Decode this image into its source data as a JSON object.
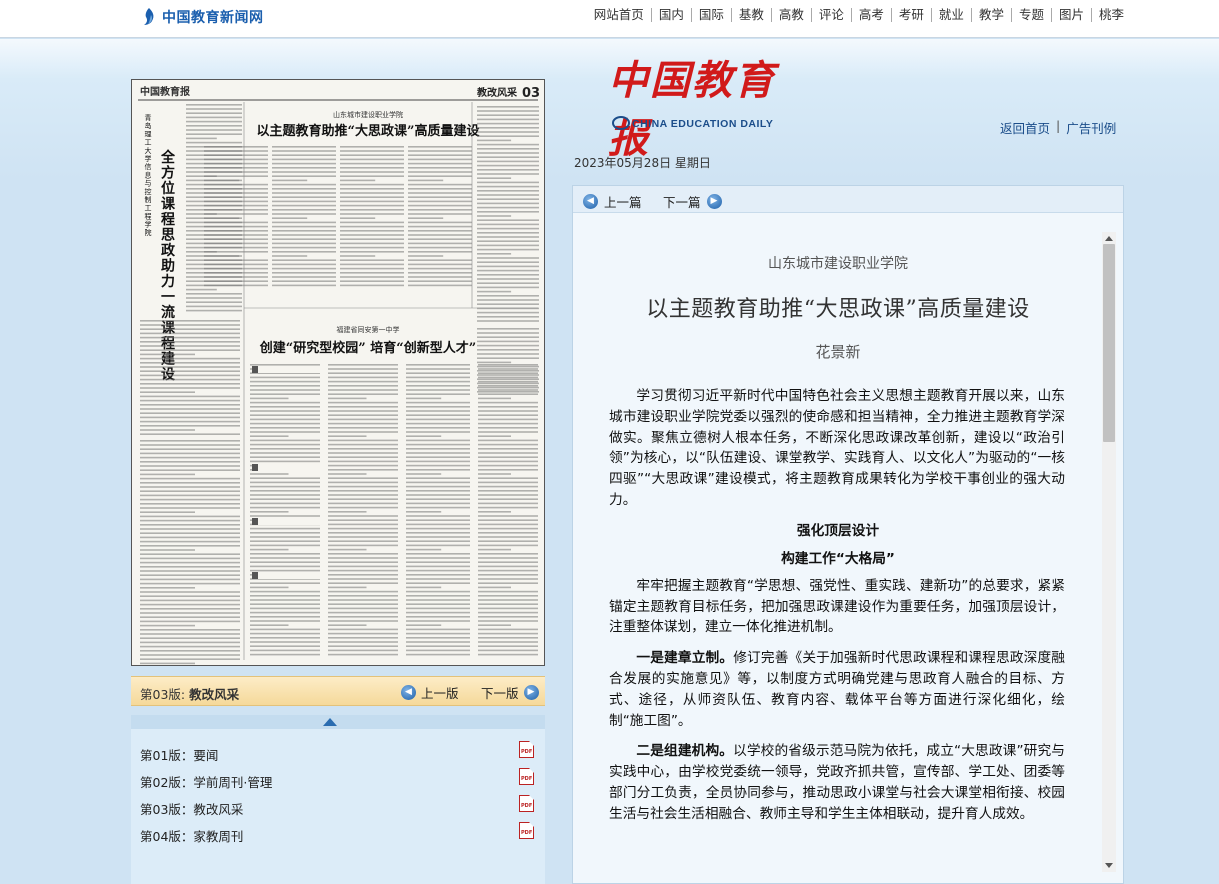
{
  "site": {
    "logo_text": "中国教育新闻网"
  },
  "nav": [
    "网站首页",
    "国内",
    "国际",
    "基教",
    "高教",
    "评论",
    "高考",
    "考研",
    "就业",
    "教学",
    "专题",
    "图片",
    "桃李"
  ],
  "masthead": {
    "cn": "中国教育报",
    "en": "CHINA EDUCATION DAILY"
  },
  "head_links": {
    "home": "返回首页",
    "archive": "广告刊例"
  },
  "date": "2023年05月28日  星期日",
  "page_bar": {
    "current_prefix": "第03版:",
    "current_name": "教改风采",
    "prev": "上一版",
    "next": "下一版"
  },
  "pages": [
    {
      "label": "第01版：要闻"
    },
    {
      "label": "第02版：学前周刊·管理"
    },
    {
      "label": "第03版：教改风采"
    },
    {
      "label": "第04版：家教周刊"
    }
  ],
  "newspaper": {
    "masthead": "中国教育报",
    "section": "教改风采",
    "page_no": "03",
    "story1_kicker": "山东城市建设职业学院",
    "story1_title": "以主题教育助推“大思政课”高质量建设",
    "side_title": "全方位课程思政助力一流课程建设",
    "side_kicker": "青岛理工大学信息与控制工程学院",
    "story2_kicker": "福建省同安第一中学",
    "story2_title": "创建“研究型校园” 培育“创新型人才”"
  },
  "article_nav": {
    "prev": "上一篇",
    "next": "下一篇"
  },
  "article": {
    "kicker": "山东城市建设职业学院",
    "title": "以主题教育助推“大思政课”高质量建设",
    "author": "花景新",
    "p1": "学习贯彻习近平新时代中国特色社会主义思想主题教育开展以来，山东城市建设职业学院党委以强烈的使命感和担当精神，全力推进主题教育学深做实。聚焦立德树人根本任务，不断深化思政课改革创新，建设以“政治引领”为核心，以“队伍建设、课堂教学、实践育人、以文化人”为驱动的“一核四驱”“大思政课”建设模式，将主题教育成果转化为学校干事创业的强大动力。",
    "subhead1": "强化顶层设计",
    "subhead2": "构建工作“大格局”",
    "p2": "牢牢把握主题教育“学思想、强党性、重实践、建新功”的总要求，紧紧锚定主题教育目标任务，把加强思政课建设作为重要任务，加强顶层设计，注重整体谋划，建立一体化推进机制。",
    "p3_lead": "一是建章立制。",
    "p3": "修订完善《关于加强新时代思政课程和课程思政深度融合发展的实施意见》等，以制度方式明确党建与思政育人融合的目标、方式、途径，从师资队伍、教育内容、载体平台等方面进行深化细化，绘制“施工图”。",
    "p4_lead": "二是组建机构。",
    "p4": "以学校的省级示范马院为依托，成立“大思政课”研究与实践中心，由学校党委统一领导，党政齐抓共管，宣传部、学工处、团委等部门分工负责，全员协同参与，推动思政小课堂与社会大课堂相衔接、校园生活与社会生活相融合、教师主导和学生主体相联动，提升育人成效。"
  }
}
